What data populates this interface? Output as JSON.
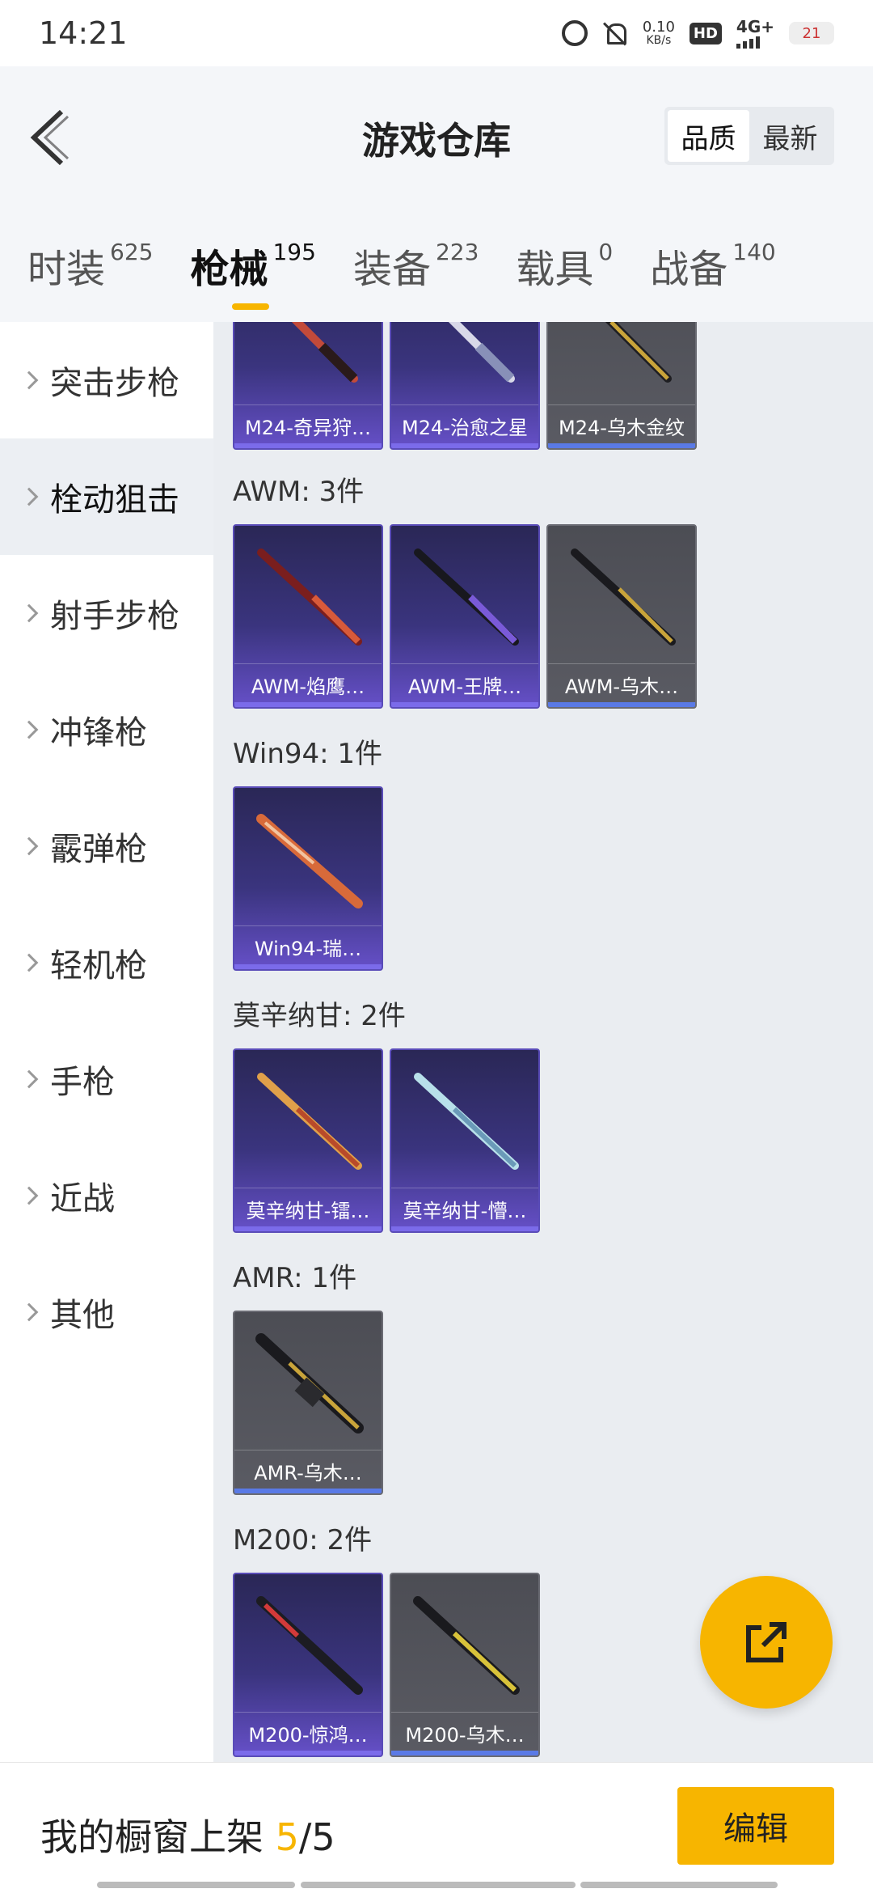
{
  "status": {
    "time": "14:21",
    "speed_value": "0.10",
    "speed_unit": "KB/s",
    "hd": "HD",
    "network": "4G+",
    "battery": "21"
  },
  "header": {
    "title": "游戏仓库",
    "sort_options": [
      "品质",
      "最新"
    ],
    "active_sort": "品质"
  },
  "tabs": [
    {
      "label": "时装",
      "count": "625"
    },
    {
      "label": "枪械",
      "count": "195"
    },
    {
      "label": "装备",
      "count": "223"
    },
    {
      "label": "载具",
      "count": "0"
    },
    {
      "label": "战备",
      "count": "140"
    }
  ],
  "sidebar": {
    "items": [
      "突击步枪",
      "栓动狙击",
      "射手步枪",
      "冲锋枪",
      "霰弹枪",
      "轻机枪",
      "手枪",
      "近战",
      "其他"
    ],
    "active": "栓动狙击"
  },
  "groups": [
    {
      "title": "",
      "items": [
        {
          "name": "M24-奇异狩…",
          "rarity": "purple"
        },
        {
          "name": "M24-治愈之星",
          "rarity": "purple"
        },
        {
          "name": "M24-乌木金纹",
          "rarity": "gray"
        }
      ]
    },
    {
      "title": "AWM: 3件",
      "items": [
        {
          "name": "AWM-焰鹰…",
          "rarity": "purple"
        },
        {
          "name": "AWM-王牌…",
          "rarity": "purple"
        },
        {
          "name": "AWM-乌木…",
          "rarity": "gray"
        }
      ]
    },
    {
      "title": "Win94: 1件",
      "items": [
        {
          "name": "Win94-瑞…",
          "rarity": "purple"
        }
      ]
    },
    {
      "title": "莫辛纳甘: 2件",
      "items": [
        {
          "name": "莫辛纳甘-镭…",
          "rarity": "purple"
        },
        {
          "name": "莫辛纳甘-懵…",
          "rarity": "purple"
        }
      ]
    },
    {
      "title": "AMR: 1件",
      "items": [
        {
          "name": "AMR-乌木…",
          "rarity": "gray"
        }
      ]
    },
    {
      "title": "M200: 2件",
      "items": [
        {
          "name": "M200-惊鸿…",
          "rarity": "purple"
        },
        {
          "name": "M200-乌木…",
          "rarity": "gray"
        }
      ]
    }
  ],
  "bottom": {
    "shelf_label": "我的橱窗上架",
    "shelf_current": "5",
    "shelf_total": "/5",
    "edit_label": "编辑"
  },
  "colors": {
    "accent": "#f7b500",
    "purple_card": "#3a347e",
    "gray_card": "#55565d"
  }
}
